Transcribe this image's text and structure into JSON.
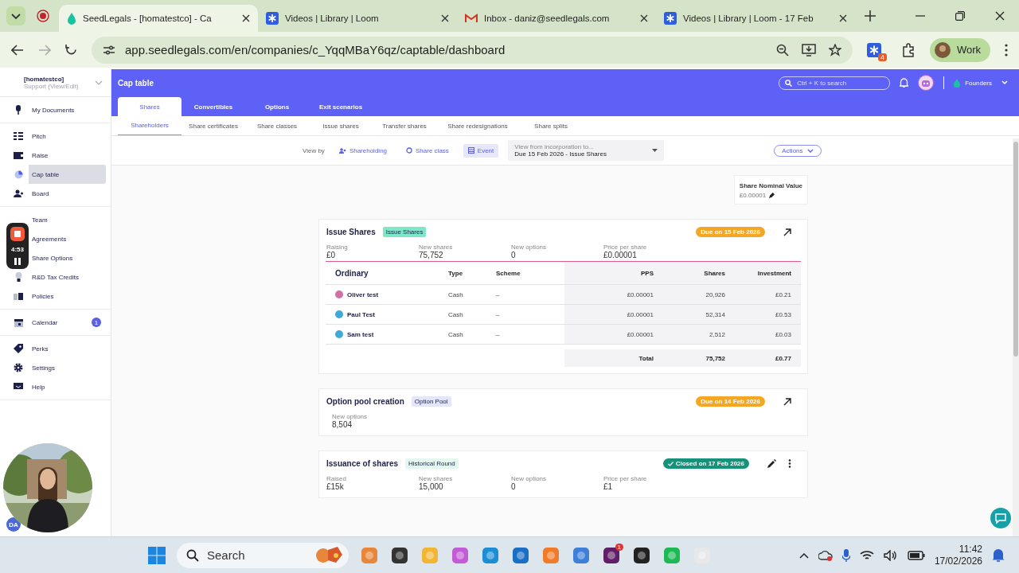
{
  "browser": {
    "tabs": [
      {
        "title": "SeedLegals - [homatestco] - Ca",
        "selected": true
      },
      {
        "title": "Videos | Library | Loom",
        "selected": false
      },
      {
        "title": "Inbox - daniz@seedlegals.com",
        "selected": false
      },
      {
        "title": "Videos | Library | Loom - 17 Feb",
        "selected": false
      }
    ],
    "url": "app.seedlegals.com/en/companies/c_YqqMBaY6qz/captable/dashboard",
    "extension_badge": "4",
    "profile": "Work"
  },
  "sidebar": {
    "company": "[homatestco]",
    "role": "Support (View/Edit)",
    "groups": [
      [
        {
          "label": "My Documents",
          "selected": false
        }
      ],
      [
        {
          "label": "Pitch",
          "selected": false
        },
        {
          "label": "Raise",
          "selected": false
        },
        {
          "label": "Cap table",
          "selected": true
        },
        {
          "label": "Board",
          "selected": false
        }
      ],
      [
        {
          "label": "Team",
          "selected": false
        },
        {
          "label": "Agreements",
          "selected": false
        },
        {
          "label": "Share Options",
          "selected": false
        },
        {
          "label": "R&D Tax Credits",
          "selected": false
        },
        {
          "label": "Policies",
          "selected": false
        }
      ],
      [
        {
          "label": "Calendar",
          "selected": false,
          "badge": "1"
        }
      ],
      [
        {
          "label": "Perks",
          "selected": false
        },
        {
          "label": "Settings",
          "selected": false
        },
        {
          "label": "Help",
          "selected": false
        }
      ]
    ],
    "user_initials": "DA"
  },
  "header": {
    "title": "Cap table",
    "search_placeholder": "Ctrl + K to search",
    "workspace": "Founders"
  },
  "tabs": [
    {
      "label": "Shares",
      "selected": true
    },
    {
      "label": "Convertibles",
      "selected": false
    },
    {
      "label": "Options",
      "selected": false
    },
    {
      "label": "Exit scenarios",
      "selected": false
    }
  ],
  "subtabs": [
    {
      "label": "Shareholders",
      "selected": true
    },
    {
      "label": "Share certificates",
      "selected": false
    },
    {
      "label": "Share classes",
      "selected": false
    },
    {
      "label": "Issue shares",
      "selected": false
    },
    {
      "label": "Transfer shares",
      "selected": false
    },
    {
      "label": "Share redesignations",
      "selected": false
    },
    {
      "label": "Share splits",
      "selected": false
    }
  ],
  "toolbar": {
    "view_by_label": "View by",
    "view_options": [
      {
        "label": "Shareholding",
        "selected": false
      },
      {
        "label": "Share class",
        "selected": false
      },
      {
        "label": "Event",
        "selected": true
      }
    ],
    "period_label": "View from incorporation to...",
    "period_value": "Due 15 Feb 2026 - Issue Shares",
    "actions": "Actions"
  },
  "nominal": {
    "label": "Share Nominal Value",
    "value": "£0.00001"
  },
  "events": [
    {
      "kind": "issue",
      "title": "Issue Shares",
      "tag": "Issue Shares",
      "status": {
        "kind": "due",
        "text": "Due on 15 Feb 2026"
      },
      "metrics": [
        {
          "label": "Raising",
          "value": "£0"
        },
        {
          "label": "New shares",
          "value": "75,752"
        },
        {
          "label": "New options",
          "value": "0"
        },
        {
          "label": "Price per share",
          "value": "£0.00001"
        }
      ],
      "table": {
        "columns": [
          "Ordinary",
          "Type",
          "Scheme",
          "PPS",
          "Shares",
          "Investment"
        ],
        "rows": [
          {
            "name": "Oliver test",
            "color": "#d36fa6",
            "type": "Cash",
            "scheme": "–",
            "pps": "£0.00001",
            "shares": "20,926",
            "investment": "£0.21"
          },
          {
            "name": "Paul Test",
            "color": "#3fa9d8",
            "type": "Cash",
            "scheme": "–",
            "pps": "£0.00001",
            "shares": "52,314",
            "investment": "£0.53"
          },
          {
            "name": "Sam test",
            "color": "#3fa9d8",
            "type": "Cash",
            "scheme": "–",
            "pps": "£0.00001",
            "shares": "2,512",
            "investment": "£0.03"
          }
        ],
        "total": {
          "label": "Total",
          "shares": "75,752",
          "investment": "£0.77"
        }
      }
    },
    {
      "kind": "pool",
      "title": "Option pool creation",
      "tag": "Option Pool",
      "status": {
        "kind": "due",
        "text": "Due on 14 Feb 2026"
      },
      "metrics": [
        {
          "label": "New options",
          "value": "8,504"
        }
      ]
    },
    {
      "kind": "historical",
      "title": "Issuance of shares",
      "tag": "Historical Round",
      "status": {
        "kind": "closed",
        "text": "Closed on 17 Feb 2026"
      },
      "metrics": [
        {
          "label": "Raised",
          "value": "£15k"
        },
        {
          "label": "New shares",
          "value": "15,000"
        },
        {
          "label": "New options",
          "value": "0"
        },
        {
          "label": "Price per share",
          "value": "£1"
        }
      ]
    }
  ],
  "recorder": {
    "time": "4:53"
  },
  "taskbar": {
    "search": "Search",
    "app_badge": "1",
    "time": "11:42",
    "date": "17/02/2026"
  }
}
